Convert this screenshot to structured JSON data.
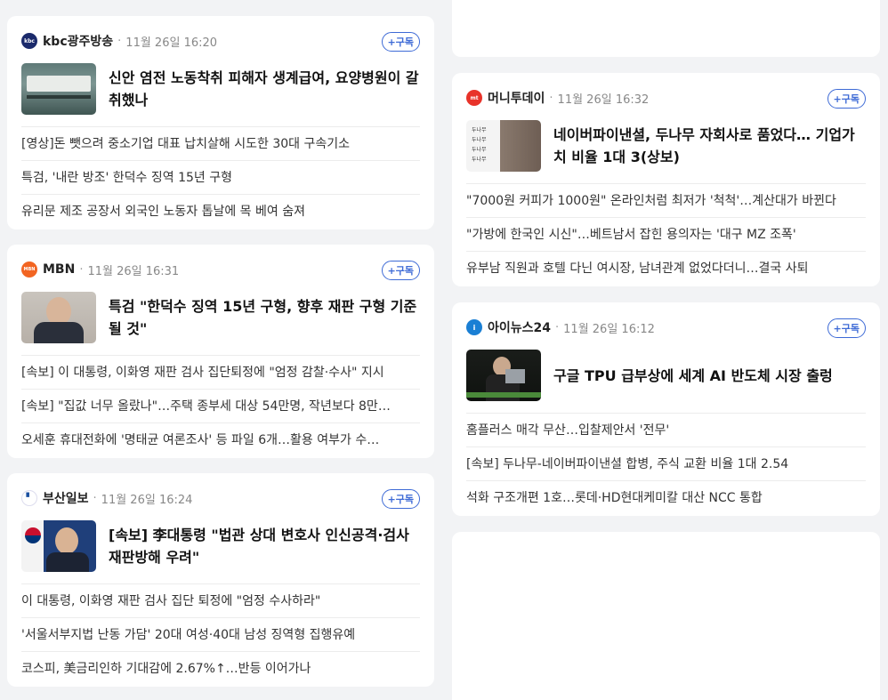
{
  "cards": [
    {
      "press": "kbc광주방송",
      "time": "11월 26일 16:20",
      "subscribe": "+구독",
      "logo_color": "#1b2a6b",
      "logo_text": "kbc",
      "headline": "신안 염전 노동착취 피해자 생계급여, 요양병원이 갈취했나",
      "items": [
        "[영상]돈 뺏으려 중소기업 대표 납치살해 시도한 30대 구속기소",
        "특검, '내란 방조' 한덕수 징역 15년 구형",
        "유리문 제조 공장서 외국인 노동자 톱날에 목 베여 숨져"
      ]
    },
    {
      "press": "MBN",
      "time": "11월 26일 16:31",
      "subscribe": "+구독",
      "logo_color": "#f26522",
      "logo_text": "MBN",
      "headline": "특검 \"한덕수 징역 15년 구형, 향후 재판 구형 기준될 것\"",
      "items": [
        "[속보] 이 대통령, 이화영 재판 검사 집단퇴정에 \"엄정 감찰·수사\" 지시",
        "[속보] \"집값 너무 올랐나\"…주택 종부세 대상 54만명, 작년보다 8만…",
        "오세훈 휴대전화에 '명태균 여론조사' 등 파일 6개…활용 여부가 수…"
      ]
    },
    {
      "press": "부산일보",
      "time": "11월 26일 16:24",
      "subscribe": "+구독",
      "logo_color": "#ffffff",
      "logo_text": "",
      "headline": "[속보] 李대통령 \"법관 상대 변호사 인신공격·검사 재판방해 우려\"",
      "items": [
        "이 대통령, 이화영 재판 검사 집단 퇴정에 \"엄정 수사하라\"",
        "'서울서부지법 난동 가담' 20대 여성·40대 남성 징역형 집행유예",
        "코스피, 美금리인하 기대감에 2.67%↑…반등 이어가나"
      ]
    },
    {
      "press": "머니투데이",
      "time": "11월 26일 16:32",
      "subscribe": "+구독",
      "logo_color": "#e8332a",
      "logo_text": "mt",
      "headline": "네이버파이낸셜, 두나무 자회사로 품었다… 기업가치 비율 1대 3(상보)",
      "thumb_text": [
        "두나무",
        "두나무",
        "두나무",
        "두나무"
      ],
      "items": [
        "\"7000원 커피가 1000원\" 온라인처럼 최저가 '척척'…계산대가 바뀐다",
        "\"가방에 한국인 시신\"…베트남서 잡힌 용의자는 '대구 MZ 조폭'",
        "유부남 직원과 호텔 다닌 여시장, 남녀관계 없었다더니…결국 사퇴"
      ]
    },
    {
      "press": "아이뉴스24",
      "time": "11월 26일 16:12",
      "subscribe": "+구독",
      "logo_color": "#1a7fd4",
      "logo_text": "i",
      "headline": "구글 TPU 급부상에 세계 AI 반도체 시장 출렁",
      "items": [
        "홈플러스 매각 무산…입찰제안서 '전무'",
        "[속보] 두나무-네이버파이낸셜 합병, 주식 교환 비율 1대 2.54",
        "석화 구조개편 1호…롯데·HD현대케미칼 대산 NCC 통합"
      ]
    }
  ]
}
